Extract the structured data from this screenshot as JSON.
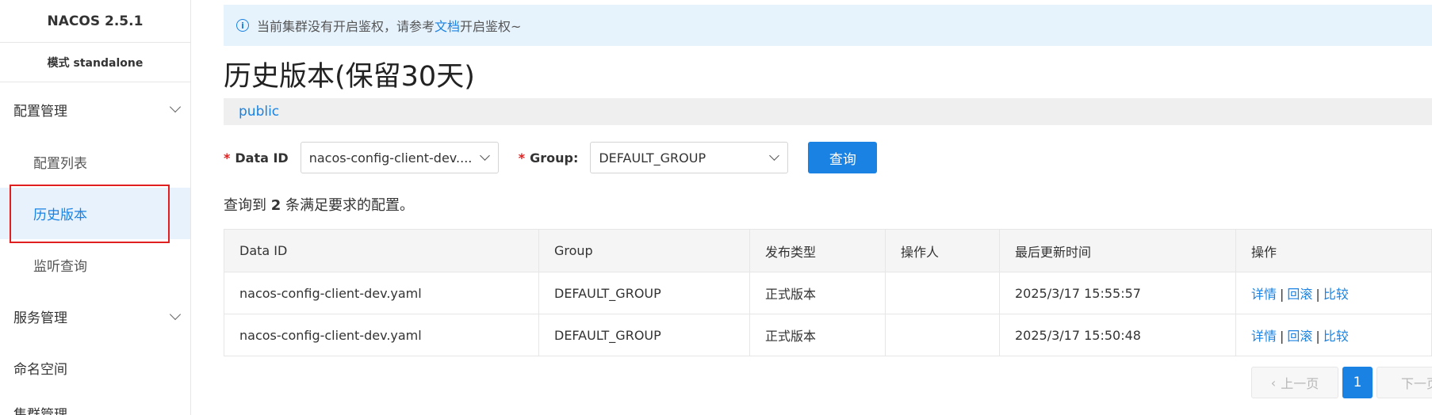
{
  "sidebar": {
    "brand": "NACOS 2.5.1",
    "mode": "模式 standalone",
    "config_group": "配置管理",
    "config_list": "配置列表",
    "history": "历史版本",
    "listen_query": "监听查询",
    "service_group": "服务管理",
    "namespace": "命名空间",
    "cluster_group": "集群管理"
  },
  "notice": {
    "prefix": "当前集群没有开启鉴权，请参考",
    "link": "文档",
    "suffix": "开启鉴权~"
  },
  "page": {
    "title": "历史版本(保留30天)",
    "namespace": "public"
  },
  "filter": {
    "data_id_label": "Data ID",
    "data_id_value": "nacos-config-client-dev....",
    "group_label": "Group:",
    "group_value": "DEFAULT_GROUP",
    "query_button": "查询"
  },
  "result": {
    "prefix": "查询到",
    "count": "2",
    "suffix": "条满足要求的配置。"
  },
  "table": {
    "headers": [
      "Data ID",
      "Group",
      "发布类型",
      "操作人",
      "最后更新时间",
      "操作"
    ],
    "rows": [
      {
        "data_id": "nacos-config-client-dev.yaml",
        "group": "DEFAULT_GROUP",
        "type": "正式版本",
        "operator": "",
        "updated": "2025/3/17 15:55:57",
        "actions": [
          "详情",
          "回滚",
          "比较"
        ]
      },
      {
        "data_id": "nacos-config-client-dev.yaml",
        "group": "DEFAULT_GROUP",
        "type": "正式版本",
        "operator": "",
        "updated": "2025/3/17 15:50:48",
        "actions": [
          "详情",
          "回滚",
          "比较"
        ]
      }
    ]
  },
  "pager": {
    "prev": "上一页",
    "current": "1",
    "next": "下一页"
  },
  "colors": {
    "primary": "#1a82e2",
    "highlight_box": "#e02020"
  }
}
